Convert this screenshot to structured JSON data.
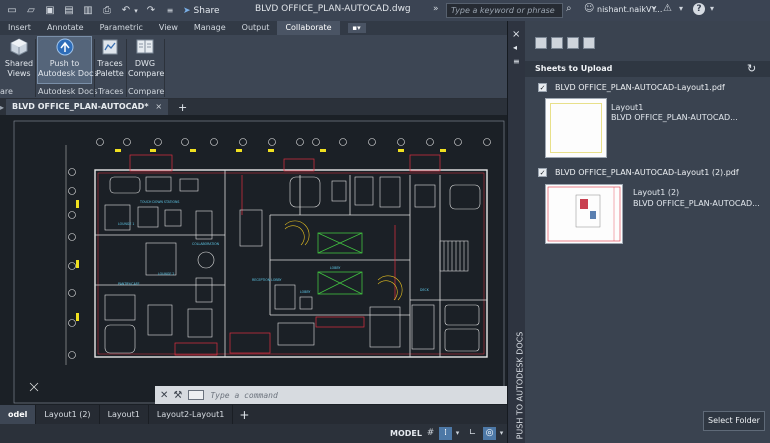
{
  "titlebar": {
    "share_label": "Share",
    "document_title": "BLVD OFFICE_PLAN-AUTOCAD.dwg",
    "search_placeholder": "Type a keyword or phrase",
    "user_name": "nishant.naikVY..."
  },
  "ribbon": {
    "tabs": [
      "Insert",
      "Annotate",
      "Parametric",
      "View",
      "Manage",
      "Output",
      "Collaborate"
    ],
    "active_tab": "Collaborate",
    "buttons": {
      "shared_views": "Shared\nViews",
      "push_to_docs": "Push to\nAutodesk Docs",
      "traces_palette": "Traces\nPalette",
      "dwg_compare": "DWG\nCompare"
    },
    "panels": {
      "left_cut": "are",
      "autodesk_docs": "Autodesk Docs",
      "traces": "Traces",
      "compare": "Compare"
    }
  },
  "file_tabs": {
    "active": "BLVD OFFICE_PLAN-AUTOCAD*",
    "close": "×",
    "add": "+"
  },
  "command_line": {
    "placeholder": "Type a command"
  },
  "layout_tabs": {
    "items": [
      "odel",
      "Layout1 (2)",
      "Layout1",
      "Layout2-Layout1"
    ],
    "add": "+"
  },
  "statusbar": {
    "mode": "MODEL"
  },
  "palette": {
    "title": "PUSH TO AUTODESK DOCS",
    "close": "×"
  },
  "panel": {
    "header": "Sheets to Upload",
    "sheets": [
      {
        "name": "BLVD OFFICE_PLAN-AUTOCAD-Layout1.pdf",
        "checked": true,
        "layout": "Layout1",
        "drawing": "BLVD OFFICE_PLAN-AUTOCAD..."
      },
      {
        "name": "BLVD OFFICE_PLAN-AUTOCAD-Layout1 (2).pdf",
        "checked": true,
        "layout": "Layout1 (2)",
        "drawing": "BLVD OFFICE_PLAN-AUTOCAD..."
      }
    ],
    "select_folder": "Select Folder"
  },
  "colors": {
    "background": "#1e2329",
    "ribbon": "#3d4654",
    "panel": "#3a4350",
    "accent": "#4d78a6",
    "drawing_walls": "#e0e0e0",
    "drawing_red": "#e03040",
    "drawing_yellow": "#f0e020",
    "drawing_cyan": "#5fc8e8",
    "drawing_green": "#40c040"
  }
}
